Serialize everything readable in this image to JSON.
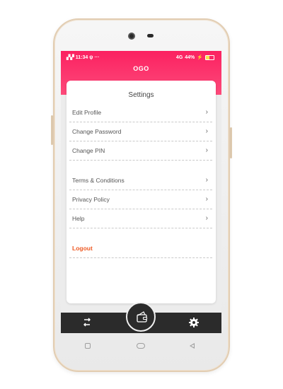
{
  "status": {
    "left_text": "4G 4G ₙᵢ 11:34 ⋔ ···",
    "time": "11:34",
    "network_right": "4G",
    "battery": "44%",
    "battery_level": 0.44
  },
  "app": {
    "title": "OGO"
  },
  "settings": {
    "title": "Settings",
    "items": [
      {
        "label": "Edit Profile",
        "chevron": "›"
      },
      {
        "label": "Change Password",
        "chevron": "›"
      },
      {
        "label": "Change PIN",
        "chevron": "›"
      },
      {
        "label": "Terms & Conditions",
        "chevron": "›"
      },
      {
        "label": "Privacy Policy",
        "chevron": "›"
      },
      {
        "label": "Help",
        "chevron": "›"
      }
    ],
    "logout_label": "Logout"
  },
  "nav": {
    "left_icon": "transfer-arrows-icon",
    "center_icon": "wallet-icon",
    "right_icon": "gear-icon"
  },
  "colors": {
    "header_pink": "#fb2161",
    "logout_orange": "#ee5a24",
    "nav_dark": "#2b2b2b"
  }
}
